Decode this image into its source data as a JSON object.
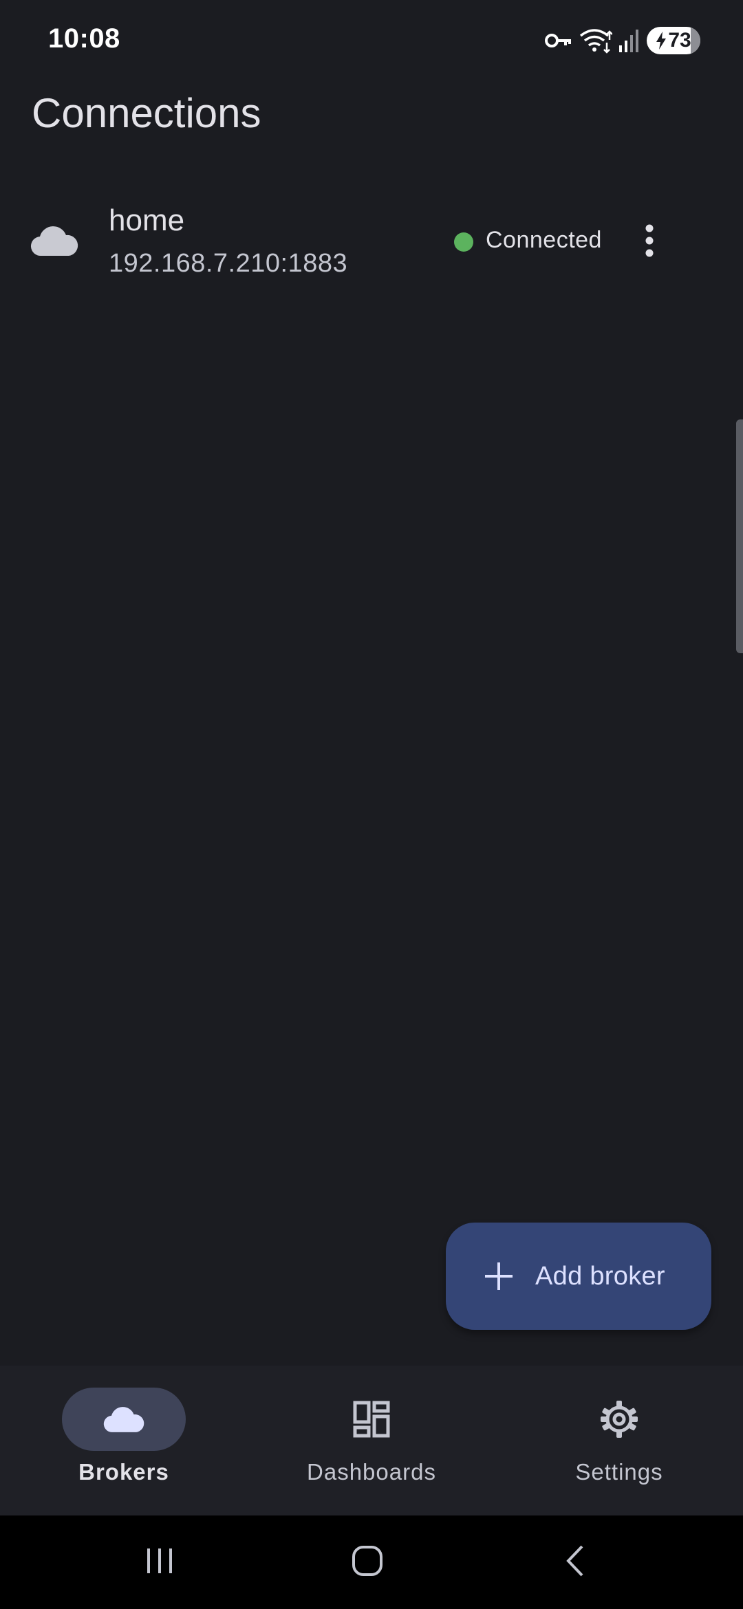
{
  "status_bar": {
    "time": "10:08",
    "battery_level": "73",
    "icons": [
      "vpn-key-icon",
      "wifi-icon",
      "signal-icon",
      "battery-charging-icon"
    ]
  },
  "page": {
    "title": "Connections"
  },
  "brokers": [
    {
      "name": "home",
      "address": "192.168.7.210:1883",
      "status": "Connected",
      "status_color": "#5cb35e",
      "icon": "cloud-icon"
    }
  ],
  "fab": {
    "label": "Add broker",
    "icon": "plus-icon",
    "color": "#344576"
  },
  "bottom_nav": {
    "items": [
      {
        "label": "Brokers",
        "icon": "cloud-icon",
        "active": true
      },
      {
        "label": "Dashboards",
        "icon": "dashboard-icon",
        "active": false
      },
      {
        "label": "Settings",
        "icon": "gear-icon",
        "active": false
      }
    ]
  },
  "system_nav": {
    "buttons": [
      "recent-apps-icon",
      "home-icon",
      "back-icon"
    ]
  }
}
